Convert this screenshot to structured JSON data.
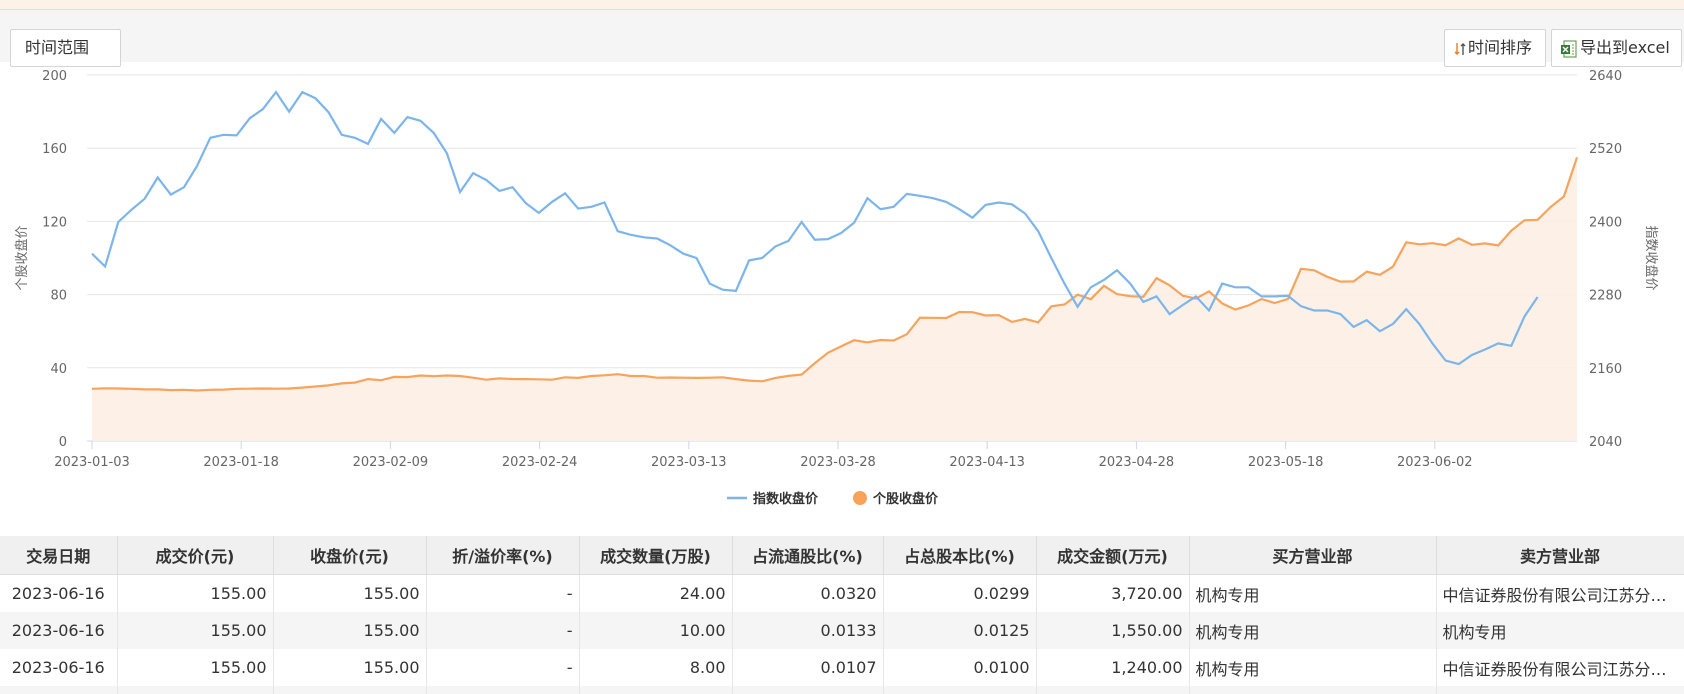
{
  "toolbar": {
    "range_label": "时间范围",
    "sort_label": "时间排序",
    "export_label": "导出到excel"
  },
  "chart_data": {
    "type": "line",
    "x_ticks": [
      "2023-01-03",
      "2023-01-18",
      "2023-02-09",
      "2023-02-24",
      "2023-03-13",
      "2023-03-28",
      "2023-04-13",
      "2023-04-28",
      "2023-05-18",
      "2023-06-02"
    ],
    "left_axis": {
      "label": "个股收盘价",
      "ticks": [
        200,
        160,
        120,
        80,
        40,
        0
      ],
      "ylim": [
        0,
        200
      ]
    },
    "right_axis": {
      "label": "指数收盘价",
      "ticks": [
        2640,
        2520,
        2400,
        2280,
        2160,
        2040
      ],
      "ylim": [
        2040,
        2640
      ]
    },
    "grid": true,
    "legend_position": "bottom-center",
    "series": [
      {
        "name": "指数收盘价",
        "axis": "right",
        "color": "#7cb5ec",
        "values": [
          2347,
          2326,
          2399,
          2419,
          2437,
          2472,
          2444,
          2456,
          2491,
          2537,
          2542,
          2541,
          2569,
          2584,
          2612,
          2580,
          2612,
          2602,
          2579,
          2542,
          2537,
          2527,
          2568,
          2545,
          2571,
          2565,
          2545,
          2512,
          2448,
          2479,
          2468,
          2450,
          2456,
          2430,
          2414,
          2432,
          2446,
          2421,
          2424,
          2431,
          2384,
          2378,
          2374,
          2372,
          2361,
          2347,
          2340,
          2298,
          2288,
          2286,
          2336,
          2340,
          2359,
          2368,
          2399,
          2370,
          2371,
          2381,
          2398,
          2438,
          2420,
          2424,
          2445,
          2442,
          2438,
          2432,
          2420,
          2406,
          2427,
          2431,
          2428,
          2413,
          2384,
          2340,
          2298,
          2260,
          2292,
          2304,
          2320,
          2298,
          2268,
          2277,
          2248,
          2263,
          2277,
          2254,
          2298,
          2292,
          2292,
          2277,
          2277,
          2278,
          2261,
          2254,
          2254,
          2248,
          2227,
          2238,
          2220,
          2232,
          2256,
          2232,
          2200,
          2172,
          2166,
          2181,
          2190,
          2200,
          2196,
          2244,
          2276
        ]
      },
      {
        "name": "个股收盘价",
        "axis": "left",
        "color": "#f7a35c",
        "values": [
          28.5,
          28.8,
          28.7,
          28.5,
          28.2,
          28.2,
          27.8,
          28.0,
          27.6,
          28.0,
          28.1,
          28.5,
          28.6,
          28.7,
          28.6,
          28.7,
          29.2,
          29.8,
          30.4,
          31.5,
          31.9,
          33.8,
          33.2,
          35.0,
          34.9,
          35.8,
          35.4,
          35.8,
          35.5,
          34.6,
          33.5,
          34.2,
          33.9,
          33.8,
          33.7,
          33.5,
          34.8,
          34.5,
          35.5,
          35.9,
          36.5,
          35.5,
          35.5,
          34.6,
          34.7,
          34.6,
          34.5,
          34.6,
          34.8,
          33.8,
          33.0,
          32.6,
          34.5,
          35.6,
          36.3,
          42.5,
          48.2,
          51.7,
          55.1,
          53.9,
          55.2,
          54.9,
          58.3,
          67.4,
          67.3,
          67.2,
          70.5,
          70.4,
          68.6,
          68.8,
          65.1,
          66.7,
          64.8,
          73.6,
          74.6,
          80.0,
          77.5,
          84.8,
          80.3,
          79.1,
          78.8,
          89.0,
          85.1,
          79.4,
          77.8,
          81.8,
          75.2,
          71.8,
          74.1,
          77.6,
          75.4,
          77.6,
          94.1,
          93.3,
          89.7,
          87.1,
          87.2,
          92.5,
          90.8,
          95.3,
          108.6,
          107.5,
          108.1,
          107.0,
          110.7,
          107.2,
          108.0,
          106.9,
          114.9,
          120.6,
          120.9,
          127.9,
          133.6,
          155.0
        ]
      }
    ]
  },
  "table": {
    "headers": [
      "交易日期",
      "成交价(元)",
      "收盘价(元)",
      "折/溢价率(%)",
      "成交数量(万股)",
      "占流通股比(%)",
      "占总股本比(%)",
      "成交金额(万元)",
      "买方营业部",
      "卖方营业部"
    ],
    "rows": [
      [
        "2023-06-16",
        "155.00",
        "155.00",
        "-",
        "24.00",
        "0.0320",
        "0.0299",
        "3,720.00",
        "机构专用",
        "中信证券股份有限公司江苏分公司"
      ],
      [
        "2023-06-16",
        "155.00",
        "155.00",
        "-",
        "10.00",
        "0.0133",
        "0.0125",
        "1,550.00",
        "机构专用",
        "机构专用"
      ],
      [
        "2023-06-16",
        "155.00",
        "155.00",
        "-",
        "8.00",
        "0.0107",
        "0.0100",
        "1,240.00",
        "机构专用",
        "中信证券股份有限公司江苏分公司"
      ]
    ]
  }
}
